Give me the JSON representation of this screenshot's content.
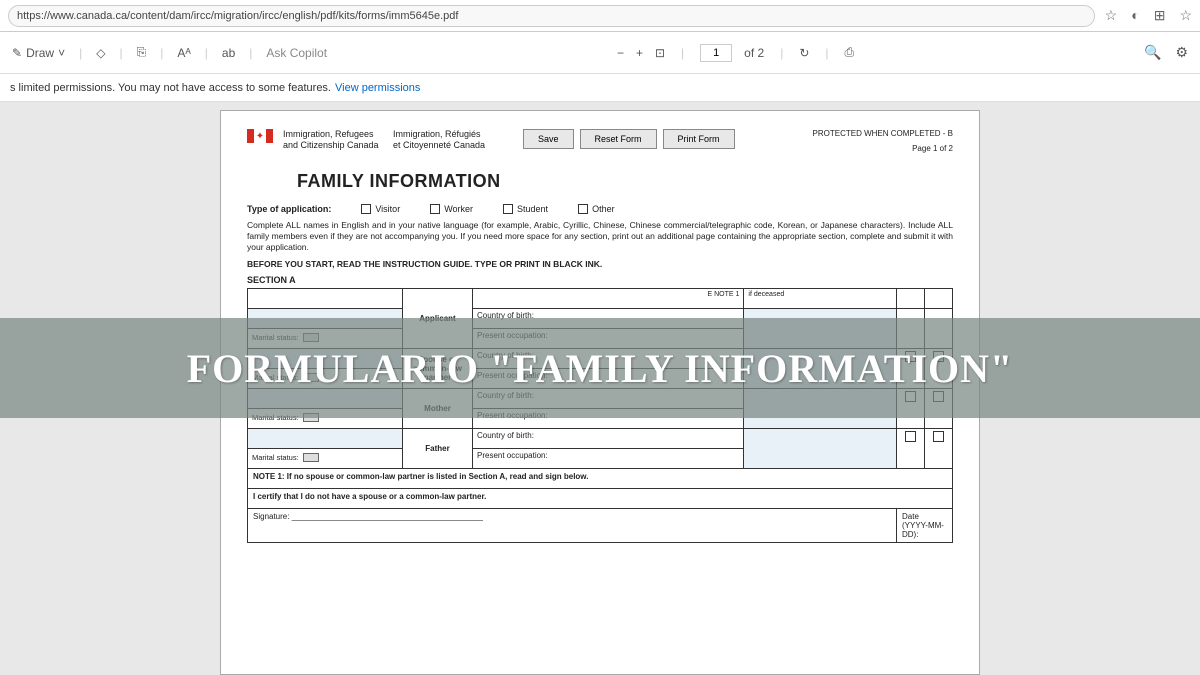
{
  "url": "https://www.canada.ca/content/dam/ircc/migration/ircc/english/pdf/kits/forms/imm5645e.pdf",
  "toolbar": {
    "draw": "Draw",
    "copilot": "Ask Copilot",
    "page_current": "1",
    "page_total": "of 2"
  },
  "permissions": {
    "text": "s limited permissions. You may not have access to some features.",
    "link": "View permissions"
  },
  "form": {
    "dept_en_1": "Immigration, Refugees",
    "dept_en_2": "and Citizenship Canada",
    "dept_fr_1": "Immigration, Réfugiés",
    "dept_fr_2": "et Citoyenneté Canada",
    "btn_save": "Save",
    "btn_reset": "Reset Form",
    "btn_print": "Print Form",
    "protected": "PROTECTED WHEN COMPLETED - B",
    "page_of": "Page 1 of 2",
    "title": "FAMILY INFORMATION",
    "type_label": "Type of application:",
    "opt_visitor": "Visitor",
    "opt_worker": "Worker",
    "opt_student": "Student",
    "opt_other": "Other",
    "instructions": "Complete ALL names in English and in your native language (for example, Arabic, Cyrillic, Chinese, Chinese commercial/telegraphic code, Korean, or Japanese characters). Include ALL family members even if they are not accompanying you. If you need more space for any section, print out an additional page containing the appropriate section, complete and submit it with your application.",
    "before": "BEFORE YOU START, READ THE INSTRUCTION GUIDE. TYPE OR PRINT IN BLACK INK.",
    "section_a": "SECTION A",
    "note1_ref": "E NOTE 1",
    "role_applicant": "Applicant",
    "role_spouse": "Spouse or common-law partner",
    "role_mother": "Mother",
    "role_father": "Father",
    "marital": "Marital status:",
    "country_birth": "Country of birth:",
    "present_occ": "Present occupation:",
    "deceased": "if deceased",
    "note1": "NOTE 1: If no spouse or common-law partner is listed in Section A, read and sign below.",
    "certify": "I certify that I do not have a spouse or a common-law partner.",
    "signature": "Signature:",
    "date": "Date (YYYY-MM-DD):"
  },
  "overlay": "FORMULARIO \"FAMILY INFORMATION\""
}
